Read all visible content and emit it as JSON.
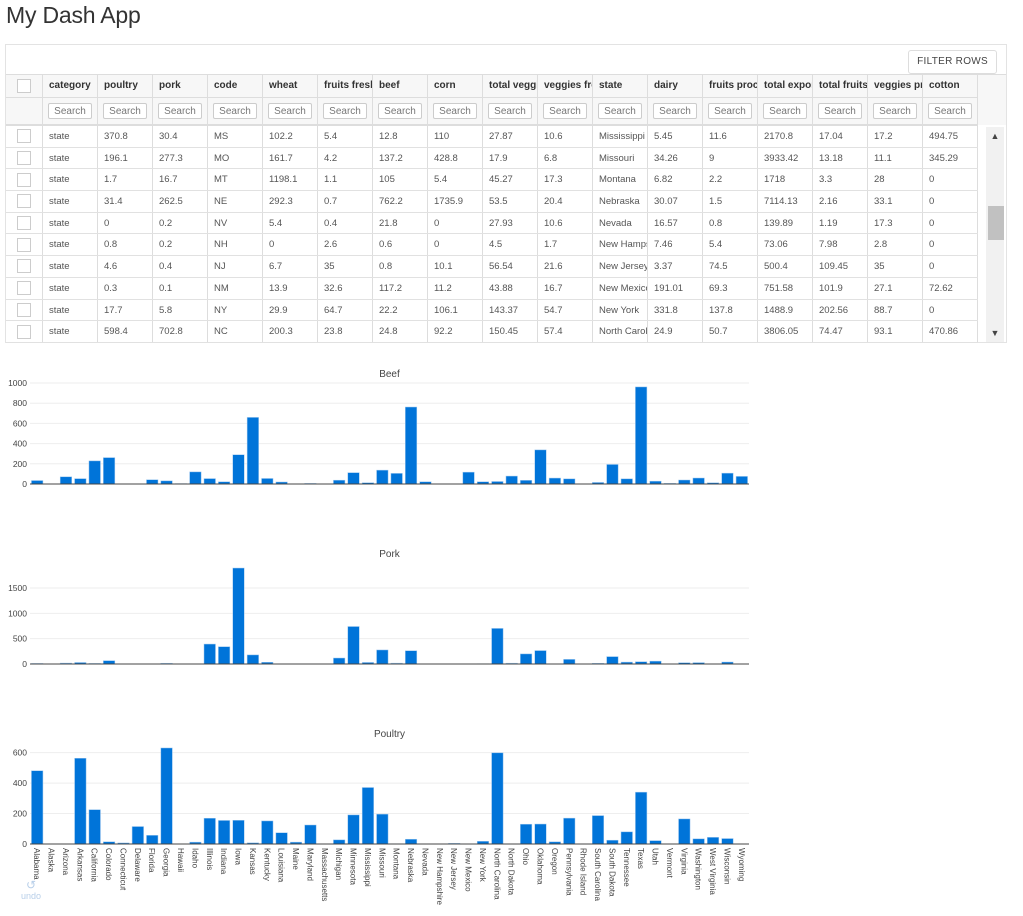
{
  "app": {
    "title": "My Dash App"
  },
  "table": {
    "filter_button": "FILTER ROWS",
    "search_placeholder": "Search",
    "columns": [
      "category",
      "poultry",
      "pork",
      "code",
      "wheat",
      "fruits fresh",
      "beef",
      "corn",
      "total veggies",
      "veggies fresh",
      "state",
      "dairy",
      "fruits proc",
      "total exports",
      "total fruits",
      "veggies proc",
      "cotton"
    ],
    "rows": [
      [
        "state",
        "370.8",
        "30.4",
        "MS",
        "102.2",
        "5.4",
        "12.8",
        "110",
        "27.87",
        "10.6",
        "Mississippi",
        "5.45",
        "11.6",
        "2170.8",
        "17.04",
        "17.2",
        "494.75"
      ],
      [
        "state",
        "196.1",
        "277.3",
        "MO",
        "161.7",
        "4.2",
        "137.2",
        "428.8",
        "17.9",
        "6.8",
        "Missouri",
        "34.26",
        "9",
        "3933.42",
        "13.18",
        "11.1",
        "345.29"
      ],
      [
        "state",
        "1.7",
        "16.7",
        "MT",
        "1198.1",
        "1.1",
        "105",
        "5.4",
        "45.27",
        "17.3",
        "Montana",
        "6.82",
        "2.2",
        "1718",
        "3.3",
        "28",
        "0"
      ],
      [
        "state",
        "31.4",
        "262.5",
        "NE",
        "292.3",
        "0.7",
        "762.2",
        "1735.9",
        "53.5",
        "20.4",
        "Nebraska",
        "30.07",
        "1.5",
        "7114.13",
        "2.16",
        "33.1",
        "0"
      ],
      [
        "state",
        "0",
        "0.2",
        "NV",
        "5.4",
        "0.4",
        "21.8",
        "0",
        "27.93",
        "10.6",
        "Nevada",
        "16.57",
        "0.8",
        "139.89",
        "1.19",
        "17.3",
        "0"
      ],
      [
        "state",
        "0.8",
        "0.2",
        "NH",
        "0",
        "2.6",
        "0.6",
        "0",
        "4.5",
        "1.7",
        "New Hampshire",
        "7.46",
        "5.4",
        "73.06",
        "7.98",
        "2.8",
        "0"
      ],
      [
        "state",
        "4.6",
        "0.4",
        "NJ",
        "6.7",
        "35",
        "0.8",
        "10.1",
        "56.54",
        "21.6",
        "New Jersey",
        "3.37",
        "74.5",
        "500.4",
        "109.45",
        "35",
        "0"
      ],
      [
        "state",
        "0.3",
        "0.1",
        "NM",
        "13.9",
        "32.6",
        "117.2",
        "11.2",
        "43.88",
        "16.7",
        "New Mexico",
        "191.01",
        "69.3",
        "751.58",
        "101.9",
        "27.1",
        "72.62"
      ],
      [
        "state",
        "17.7",
        "5.8",
        "NY",
        "29.9",
        "64.7",
        "22.2",
        "106.1",
        "143.37",
        "54.7",
        "New York",
        "331.8",
        "137.8",
        "1488.9",
        "202.56",
        "88.7",
        "0"
      ],
      [
        "state",
        "598.4",
        "702.8",
        "NC",
        "200.3",
        "23.8",
        "24.8",
        "92.2",
        "150.45",
        "57.4",
        "North Carolina",
        "24.9",
        "50.7",
        "3806.05",
        "74.47",
        "93.1",
        "470.86"
      ]
    ],
    "scroll_position": 0.42
  },
  "undo": {
    "label": "undo"
  },
  "chart_data": [
    {
      "type": "bar",
      "title": "Beef",
      "xlabel": "",
      "ylabel": "",
      "ylim": [
        0,
        1000
      ],
      "yticks": [
        0,
        200,
        400,
        600,
        800,
        1000
      ],
      "grid": true,
      "color": "#0074d9",
      "categories": [
        "Alabama",
        "Alaska",
        "Arizona",
        "Arkansas",
        "California",
        "Colorado",
        "Connecticut",
        "Delaware",
        "Florida",
        "Georgia",
        "Hawaii",
        "Idaho",
        "Illinois",
        "Indiana",
        "Iowa",
        "Kansas",
        "Kentucky",
        "Louisiana",
        "Maine",
        "Maryland",
        "Massachusetts",
        "Michigan",
        "Minnesota",
        "Mississippi",
        "Missouri",
        "Montana",
        "Nebraska",
        "Nevada",
        "New Hampshire",
        "New Jersey",
        "New Mexico",
        "New York",
        "North Carolina",
        "North Dakota",
        "Ohio",
        "Oklahoma",
        "Oregon",
        "Pennsylvania",
        "Rhode Island",
        "South Carolina",
        "South Dakota",
        "Tennessee",
        "Texas",
        "Utah",
        "Vermont",
        "Virginia",
        "Washington",
        "West Virginia",
        "Wisconsin",
        "Wyoming"
      ],
      "values": [
        34.4,
        0,
        71.3,
        53.2,
        228.7,
        261.4,
        1.1,
        0.4,
        42.6,
        31,
        4,
        119.8,
        53.7,
        21.9,
        289.8,
        659.3,
        54.8,
        19.8,
        1.4,
        5.6,
        0.6,
        37.7,
        112.3,
        12.8,
        137.2,
        105,
        762.2,
        21.8,
        0.6,
        0.8,
        117.2,
        22.2,
        24.8,
        78.5,
        36.2,
        337.6,
        58.8,
        50.9,
        0.1,
        15.2,
        193.5,
        51.1,
        961,
        27.9,
        6.2,
        39.5,
        59.2,
        12,
        107.3,
        75.1
      ],
      "show_xticklabels": false
    },
    {
      "type": "bar",
      "title": "Pork",
      "xlabel": "",
      "ylabel": "",
      "ylim": [
        0,
        1995
      ],
      "yticks": [
        0,
        500,
        1000,
        1500
      ],
      "grid": true,
      "color": "#0074d9",
      "categories": [
        "Alabama",
        "Alaska",
        "Arizona",
        "Arkansas",
        "California",
        "Colorado",
        "Connecticut",
        "Delaware",
        "Florida",
        "Georgia",
        "Hawaii",
        "Idaho",
        "Illinois",
        "Indiana",
        "Iowa",
        "Kansas",
        "Kentucky",
        "Louisiana",
        "Maine",
        "Maryland",
        "Massachusetts",
        "Michigan",
        "Minnesota",
        "Mississippi",
        "Missouri",
        "Montana",
        "Nebraska",
        "Nevada",
        "New Hampshire",
        "New Jersey",
        "New Mexico",
        "New York",
        "North Carolina",
        "North Dakota",
        "Ohio",
        "Oklahoma",
        "Oregon",
        "Pennsylvania",
        "Rhode Island",
        "South Carolina",
        "South Dakota",
        "Tennessee",
        "Texas",
        "Utah",
        "Vermont",
        "Virginia",
        "Washington",
        "West Virginia",
        "Wisconsin",
        "Wyoming"
      ],
      "values": [
        10.6,
        0.1,
        17.9,
        29.4,
        11.1,
        66,
        0.1,
        1.7,
        0.1,
        15.2,
        0.6,
        4.4,
        394,
        341.9,
        1895.6,
        179.4,
        34.2,
        0.2,
        0.5,
        3.1,
        0.5,
        118.1,
        740.4,
        30.4,
        277.3,
        16.7,
        262.5,
        0.2,
        0.2,
        0.4,
        0.1,
        5.8,
        702.8,
        16.1,
        199.1,
        265.3,
        1.4,
        91.3,
        0.1,
        13.9,
        145.9,
        37.5,
        45.3,
        56.5,
        0.2,
        25.7,
        27.4,
        0.2,
        38.9,
        1.5
      ],
      "show_xticklabels": false
    },
    {
      "type": "bar",
      "title": "Poultry",
      "xlabel": "",
      "ylabel": "",
      "ylim": [
        0,
        663
      ],
      "yticks": [
        0,
        200,
        400,
        600
      ],
      "grid": true,
      "color": "#0074d9",
      "categories": [
        "Alabama",
        "Alaska",
        "Arizona",
        "Arkansas",
        "California",
        "Colorado",
        "Connecticut",
        "Delaware",
        "Florida",
        "Georgia",
        "Hawaii",
        "Idaho",
        "Illinois",
        "Indiana",
        "Iowa",
        "Kansas",
        "Kentucky",
        "Louisiana",
        "Maine",
        "Maryland",
        "Massachusetts",
        "Michigan",
        "Minnesota",
        "Mississippi",
        "Missouri",
        "Montana",
        "Nebraska",
        "Nevada",
        "New Hampshire",
        "New Jersey",
        "New Mexico",
        "New York",
        "North Carolina",
        "North Dakota",
        "Ohio",
        "Oklahoma",
        "Oregon",
        "Pennsylvania",
        "Rhode Island",
        "South Carolina",
        "South Dakota",
        "Tennessee",
        "Texas",
        "Utah",
        "Vermont",
        "Virginia",
        "Washington",
        "West Virginia",
        "Wisconsin",
        "Wyoming"
      ],
      "values": [
        481,
        0,
        0,
        562.9,
        225.4,
        14.5,
        6.9,
        114.7,
        56.9,
        630.4,
        1.3,
        12.2,
        169.1,
        154.6,
        155.5,
        7.4,
        151.4,
        74,
        12.3,
        124.7,
        0.6,
        27.1,
        190.8,
        370.8,
        196.1,
        1.7,
        31.4,
        0,
        0.8,
        4.6,
        0.3,
        17.7,
        598.4,
        0,
        129.9,
        131,
        14.2,
        169.8,
        0.6,
        186.5,
        24.9,
        79.7,
        340.3,
        22.1,
        1.6,
        164.6,
        33.8,
        43.7,
        35.8,
        0
      ],
      "show_xticklabels": true
    }
  ]
}
